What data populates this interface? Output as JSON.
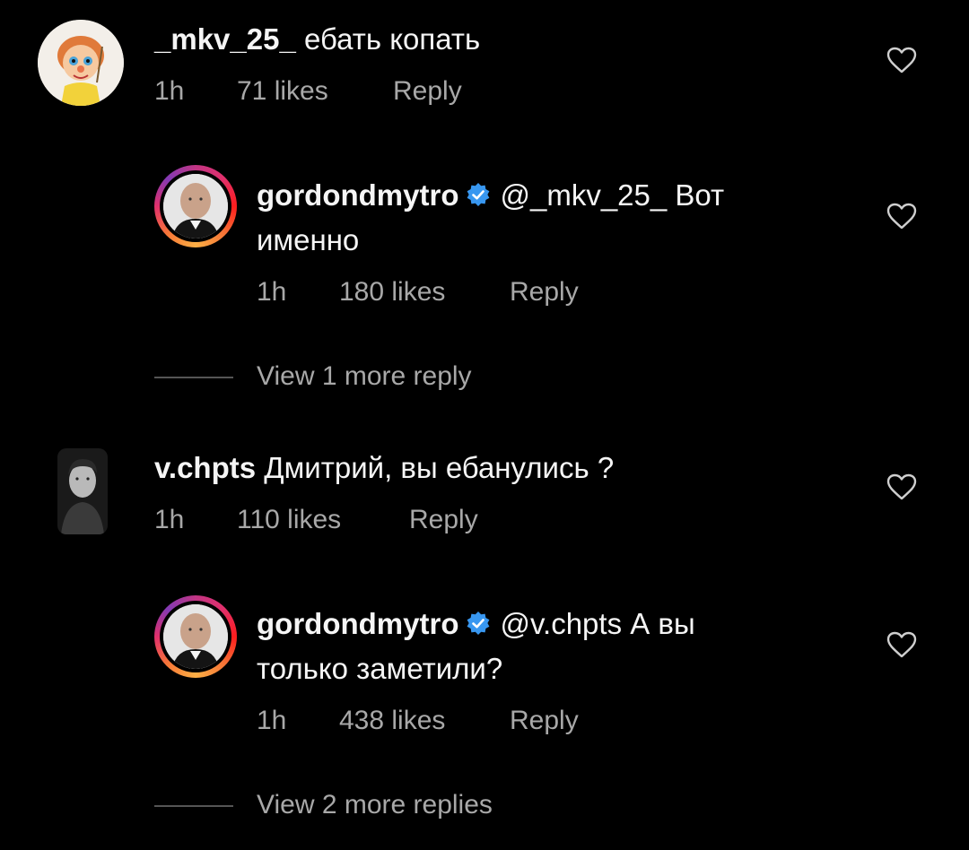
{
  "comments": [
    {
      "username": "_mkv_25_",
      "text": "ебать копать",
      "time": "1h",
      "likes": "71 likes",
      "reply_label": "Reply"
    },
    {
      "username": "gordondmytro",
      "mention": "@_mkv_25_",
      "text_line1": "Вот",
      "text_line2": "именно",
      "time": "1h",
      "likes": "180 likes",
      "reply_label": "Reply",
      "view_more": "View 1 more reply"
    },
    {
      "username": "v.chpts",
      "text": "Дмитрий, вы ебанулись ?",
      "time": "1h",
      "likes": "110 likes",
      "reply_label": "Reply"
    },
    {
      "username": "gordondmytro",
      "mention": "@v.chpts",
      "text_line1": "А вы",
      "text_line2": "только заметили?",
      "time": "1h",
      "likes": "438 likes",
      "reply_label": "Reply",
      "view_more": "View 2 more replies"
    }
  ],
  "icons": {
    "heart": "heart-outline-icon",
    "verified": "verified-badge-icon"
  },
  "colors": {
    "background": "#000000",
    "text": "#f5f5f5",
    "secondary_text": "#a8a8a8",
    "verified_blue": "#3897f0"
  }
}
